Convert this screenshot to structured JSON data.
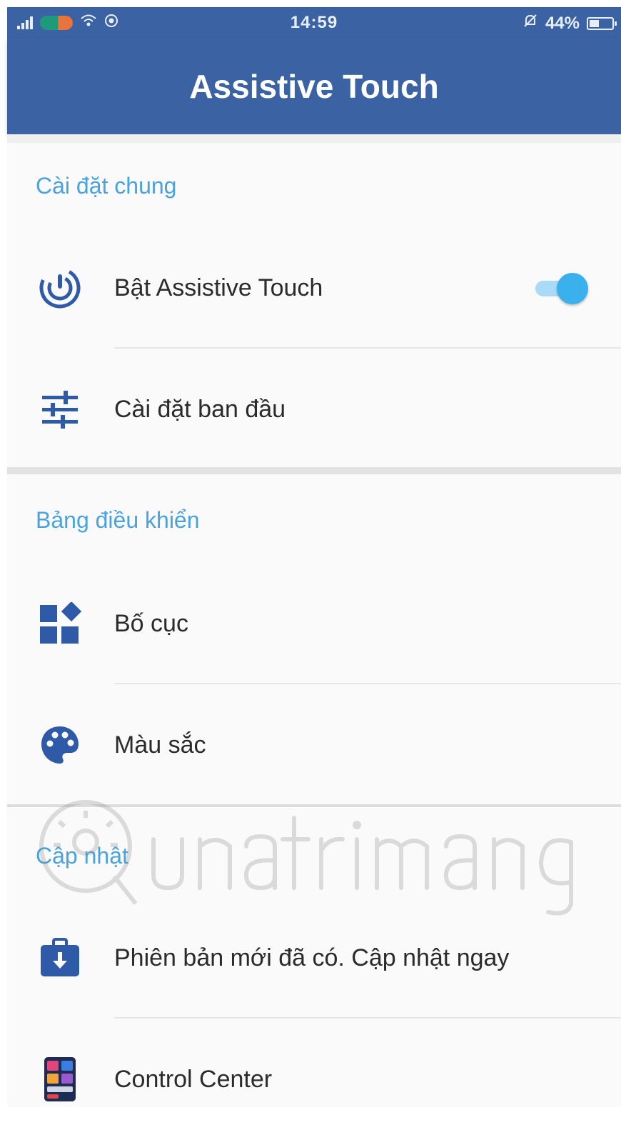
{
  "status_bar": {
    "time": "14:59",
    "battery_percent": "44%",
    "battery_level": 0.44
  },
  "app_bar": {
    "title": "Assistive Touch"
  },
  "sections": [
    {
      "header": "Cài đặt chung",
      "items": [
        {
          "label": "Bật Assistive Touch",
          "icon": "assistive-touch-icon",
          "toggle": true
        },
        {
          "label": "Cài đặt ban đầu",
          "icon": "sliders-icon"
        }
      ]
    },
    {
      "header": "Bảng điều khiển",
      "items": [
        {
          "label": "Bố cục",
          "icon": "layout-icon"
        },
        {
          "label": "Màu sắc",
          "icon": "palette-icon"
        }
      ]
    },
    {
      "header": "Cập nhật",
      "items": [
        {
          "label": "Phiên bản mới đã có. Cập nhật ngay",
          "icon": "update-bag-icon"
        },
        {
          "label": "Control Center",
          "icon": "control-center-app-icon"
        }
      ]
    }
  ],
  "watermark": "Quantrimang",
  "colors": {
    "primary": "#3b63a4",
    "section_header": "#4aa3df",
    "icon": "#2f5aa8",
    "toggle_on": "#3ab0ec"
  }
}
